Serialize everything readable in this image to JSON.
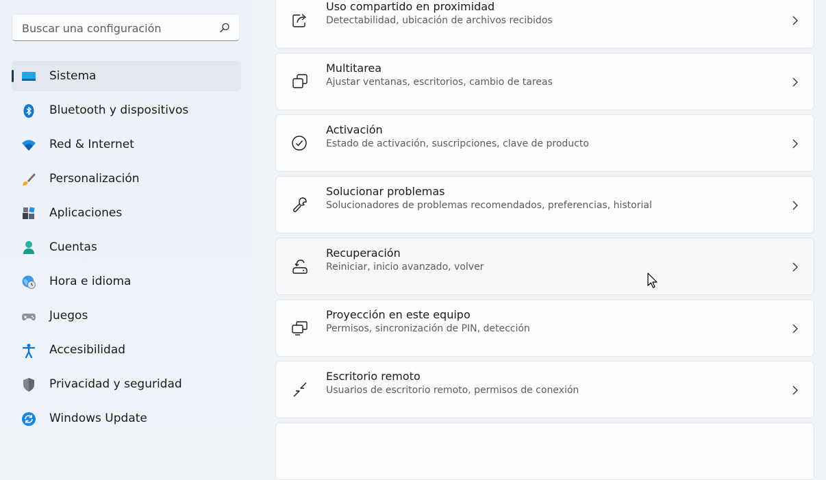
{
  "search": {
    "placeholder": "Buscar una configuración"
  },
  "sidebar": {
    "items": [
      {
        "label": "Sistema",
        "icon": "monitor-icon",
        "active": true
      },
      {
        "label": "Bluetooth y dispositivos",
        "icon": "bluetooth-icon"
      },
      {
        "label": "Red & Internet",
        "icon": "wifi-icon"
      },
      {
        "label": "Personalización",
        "icon": "paintbrush-icon"
      },
      {
        "label": "Aplicaciones",
        "icon": "apps-icon"
      },
      {
        "label": "Cuentas",
        "icon": "account-icon"
      },
      {
        "label": "Hora e idioma",
        "icon": "globe-clock-icon"
      },
      {
        "label": "Juegos",
        "icon": "gamepad-icon"
      },
      {
        "label": "Accesibilidad",
        "icon": "accessibility-icon"
      },
      {
        "label": "Privacidad y seguridad",
        "icon": "shield-icon"
      },
      {
        "label": "Windows Update",
        "icon": "update-icon"
      }
    ]
  },
  "main": {
    "cards": [
      {
        "title": "Uso compartido en proximidad",
        "subtitle": "Detectabilidad, ubicación de archivos recibidos",
        "icon": "share-icon"
      },
      {
        "title": "Multitarea",
        "subtitle": "Ajustar ventanas, escritorios, cambio de tareas",
        "icon": "multitask-icon"
      },
      {
        "title": "Activación",
        "subtitle": "Estado de activación, suscripciones, clave de producto",
        "icon": "check-circle-icon"
      },
      {
        "title": "Solucionar problemas",
        "subtitle": "Solucionadores de problemas recomendados, preferencias, historial",
        "icon": "wrench-icon"
      },
      {
        "title": "Recuperación",
        "subtitle": "Reiniciar, inicio avanzado, volver",
        "icon": "recovery-icon"
      },
      {
        "title": "Proyección en este equipo",
        "subtitle": "Permisos, sincronización de PIN, detección",
        "icon": "projection-icon"
      },
      {
        "title": "Escritorio remoto",
        "subtitle": "Usuarios de escritorio remoto, permisos de conexión",
        "icon": "remote-desktop-icon"
      }
    ]
  },
  "colors": {
    "accent": "#0067c0",
    "active_bg": "#e3e7ee",
    "indicator": "#1b3a57"
  }
}
